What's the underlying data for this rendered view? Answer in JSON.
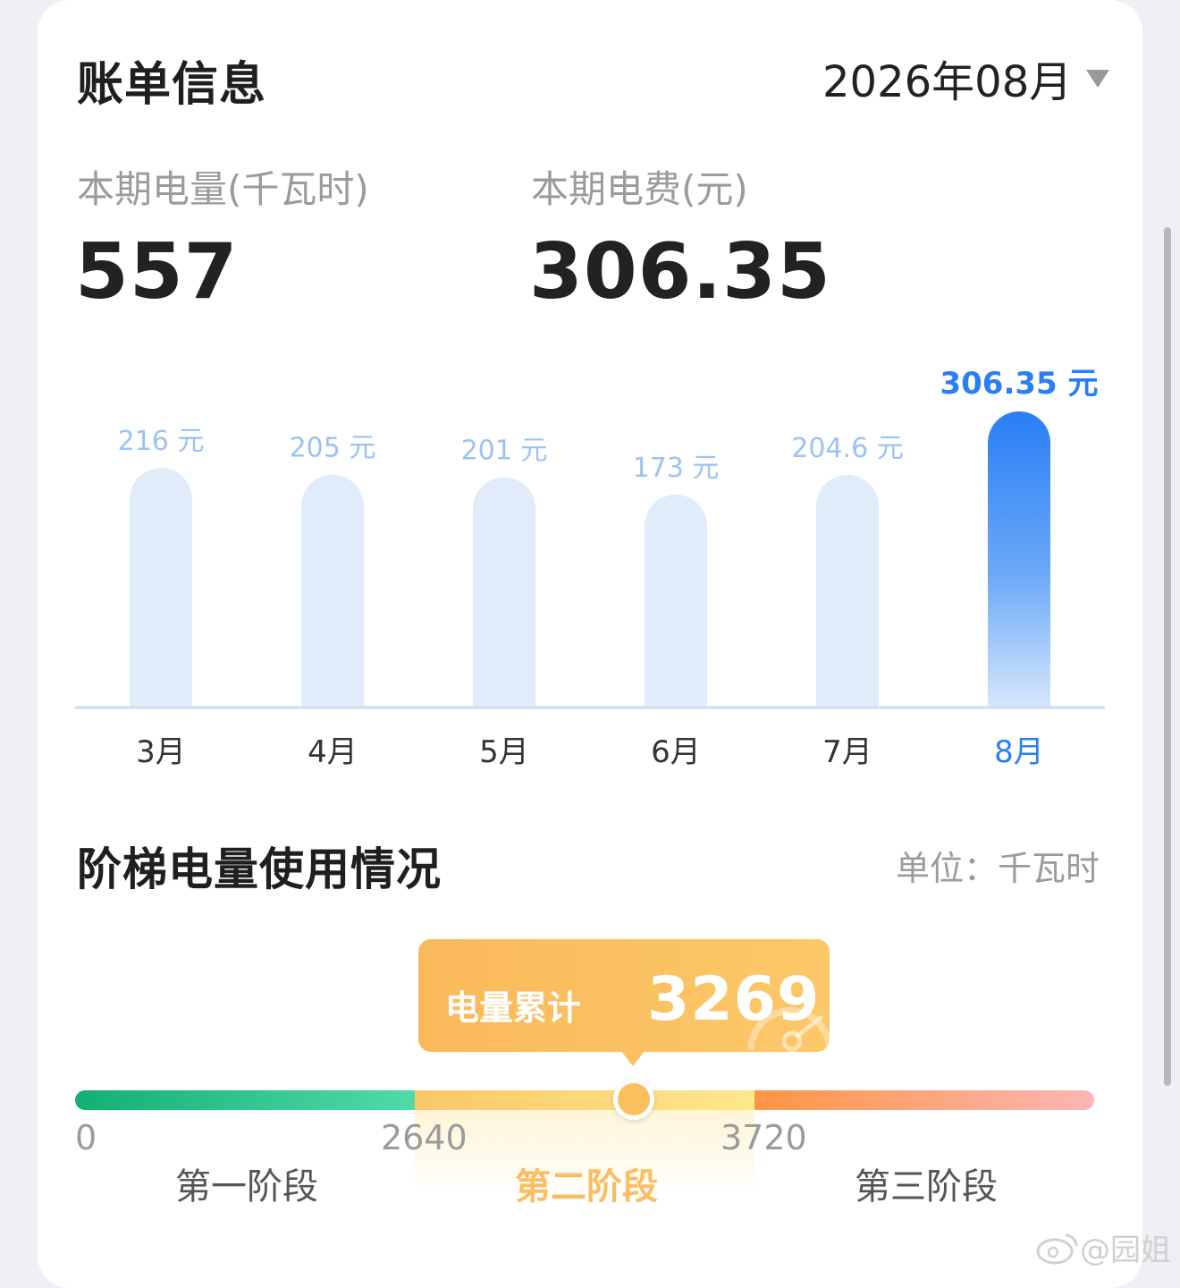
{
  "header": {
    "title": "账单信息",
    "month": "2026年08月"
  },
  "summary": {
    "usage_label": "本期电量(千瓦时)",
    "usage_value": "557",
    "fee_label": "本期电费(元)",
    "fee_value": "306.35"
  },
  "chart_data": {
    "type": "bar",
    "categories": [
      "3月",
      "4月",
      "5月",
      "6月",
      "7月",
      "8月"
    ],
    "values": [
      216,
      205,
      201,
      173,
      204.6,
      306.35
    ],
    "data_labels": [
      "216 元",
      "205 元",
      "201 元",
      "173 元",
      "204.6 元",
      "306.35 元"
    ],
    "highlight_index": 5,
    "colors": {
      "normal_bar": "#e0ecfa",
      "normal_label": "#9cc3ee",
      "highlight": "#2a7ef6",
      "axis": "#c9dcf3"
    }
  },
  "tier": {
    "title": "阶梯电量使用情况",
    "unit": "单位：千瓦时",
    "cumulative_label": "电量累计",
    "cumulative_value": "3269",
    "value": 3269,
    "thresholds": [
      "0",
      "2640",
      "3720"
    ],
    "stages": [
      "第一阶段",
      "第二阶段",
      "第三阶段"
    ],
    "active_stage": 1,
    "colors": {
      "stage1": "#12b074",
      "stage2": "#fbc768",
      "stage3": "#fd9543",
      "tooltip": "#fbc163"
    }
  },
  "watermark": "@园姐"
}
